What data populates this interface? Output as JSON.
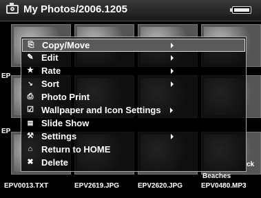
{
  "header": {
    "title": "My Photos/2006.1205",
    "camera_icon": "camera-icon",
    "battery_icon": "battery-icon"
  },
  "thumbnails": {
    "side_labels": [
      "EP",
      "EP"
    ],
    "overlay_labels": [
      "Beaches",
      "ck"
    ]
  },
  "files": [
    "EPV0013.TXT",
    "EPV2619.JPG",
    "EPV2620.JPG",
    "EPV0480.MP3"
  ],
  "menu": {
    "items": [
      {
        "label": "Copy/Move",
        "icon": "copy-icon",
        "submenu": true,
        "selected": true
      },
      {
        "label": "Edit",
        "icon": "pencil-icon",
        "submenu": true,
        "selected": false
      },
      {
        "label": "Rate",
        "icon": "star-icon",
        "submenu": true,
        "selected": false
      },
      {
        "label": "Sort",
        "icon": "sort-icon",
        "submenu": true,
        "selected": false
      },
      {
        "label": "Photo Print",
        "icon": "printer-icon",
        "submenu": false,
        "selected": false
      },
      {
        "label": "Wallpaper and Icon Settings",
        "icon": "wallpaper-icon",
        "submenu": true,
        "selected": false
      },
      {
        "label": "Slide Show",
        "icon": "slideshow-icon",
        "submenu": false,
        "selected": false
      },
      {
        "label": "Settings",
        "icon": "wrench-icon",
        "submenu": true,
        "selected": false
      },
      {
        "label": "Return to HOME",
        "icon": "home-icon",
        "submenu": false,
        "selected": false
      },
      {
        "label": "Delete",
        "icon": "trash-icon",
        "submenu": false,
        "selected": false
      }
    ]
  },
  "colors": {
    "background": "#000000",
    "highlight": "#5a5a5a",
    "text": "#ffffff"
  }
}
